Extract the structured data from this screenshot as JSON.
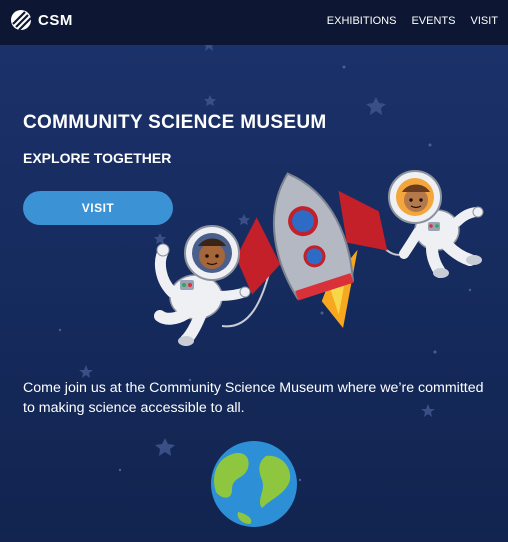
{
  "header": {
    "logo_text": "CSM",
    "nav": [
      {
        "label": "EXHIBITIONS"
      },
      {
        "label": "EVENTS"
      },
      {
        "label": "VISIT"
      }
    ]
  },
  "hero": {
    "title": "COMMUNITY SCIENCE MUSEUM",
    "subtitle": "EXPLORE TOGETHER",
    "button_label": "VISIT",
    "description": "Come join us at the Community Science Museum where we’re committed to making science accessible to all."
  },
  "colors": {
    "header_bg": "#0d1733",
    "hero_bg": "#152a5c",
    "button": "#3b93d6"
  }
}
